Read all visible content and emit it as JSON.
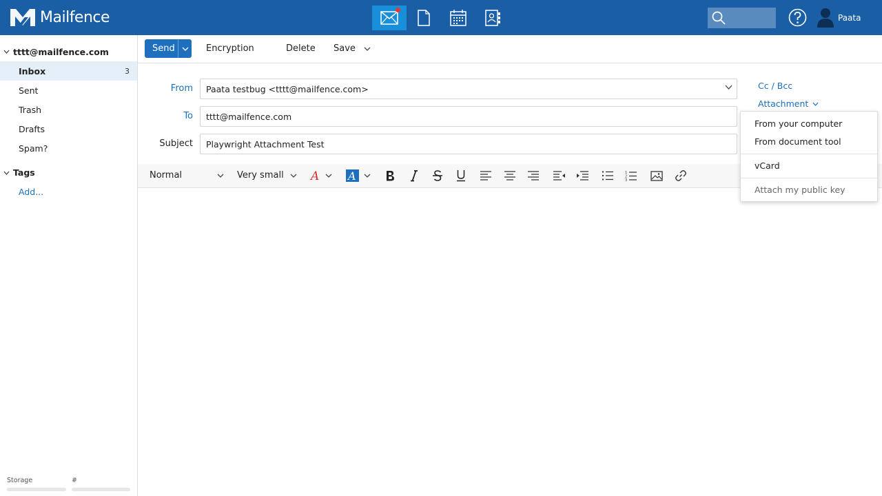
{
  "app": {
    "brand": "Mailfence",
    "user_name": "Paata",
    "colors": {
      "topbar": "#1a5fa6",
      "active_app": "#1a8fd9",
      "accent": "#1e6fbe",
      "link": "#1a6fbf",
      "notification": "#e53935"
    }
  },
  "topbar": {
    "apps": [
      {
        "name": "mail-app-icon",
        "active": true,
        "has_notification": true
      },
      {
        "name": "document-app-icon",
        "active": false
      },
      {
        "name": "calendar-app-icon",
        "active": false
      },
      {
        "name": "contacts-app-icon",
        "active": false
      }
    ]
  },
  "sidebar": {
    "account": "tttt@mailfence.com",
    "folders": [
      {
        "label": "Inbox",
        "count": "3",
        "selected": true
      },
      {
        "label": "Sent",
        "count": ""
      },
      {
        "label": "Trash",
        "count": ""
      },
      {
        "label": "Drafts",
        "count": ""
      },
      {
        "label": "Spam?",
        "count": ""
      }
    ],
    "tags_heading": "Tags",
    "tags_add": "Add...",
    "storage_label": "Storage",
    "count_label": "#"
  },
  "toolbar": {
    "send": "Send",
    "encryption": "Encryption",
    "delete": "Delete",
    "save": "Save"
  },
  "compose": {
    "from_label": "From",
    "from_value": "Paata testbug <tttt@mailfence.com>",
    "to_label": "To",
    "to_value": "tttt@mailfence.com",
    "subject_label": "Subject",
    "subject_value": "Playwright Attachment Test",
    "cc_bcc": "Cc / Bcc",
    "attachment": "Attachment"
  },
  "editor": {
    "format": "Normal",
    "size": "Very small"
  },
  "attachment_menu": {
    "items": [
      {
        "label": "From your computer"
      },
      {
        "label": "From document tool"
      },
      {
        "label": "vCard"
      },
      {
        "label": "Attach my public key"
      }
    ]
  }
}
